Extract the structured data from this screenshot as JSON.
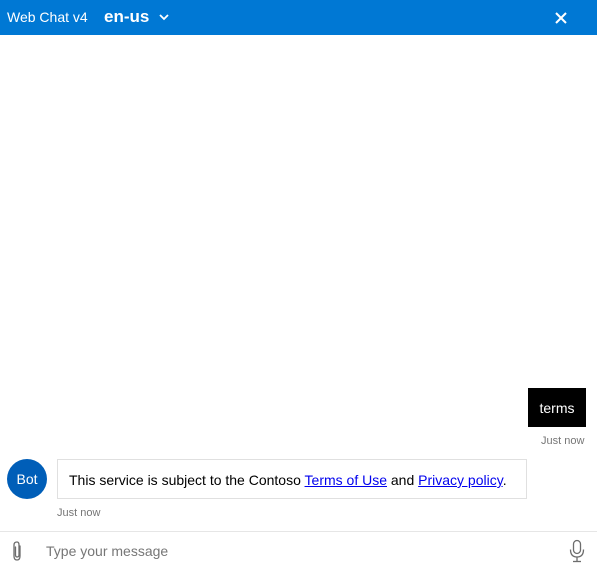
{
  "header": {
    "title": "Web Chat v4",
    "locale": "en-us",
    "close_icon": "close-icon",
    "dropdown_icon": "chevron-down-icon",
    "bg_color": "#0078d4"
  },
  "transcript": {
    "user_message": {
      "text": "terms",
      "timestamp": "Just now"
    },
    "bot_message": {
      "avatar_initials": "Bot",
      "text_before": "This service is subject to the Contoso ",
      "link1": "Terms of Use",
      "text_middle": " and ",
      "link2": "Privacy policy",
      "text_after": ".",
      "timestamp": "Just now"
    }
  },
  "sendbox": {
    "placeholder": "Type your message",
    "attach_icon": "paperclip-icon",
    "mic_icon": "microphone-icon"
  }
}
